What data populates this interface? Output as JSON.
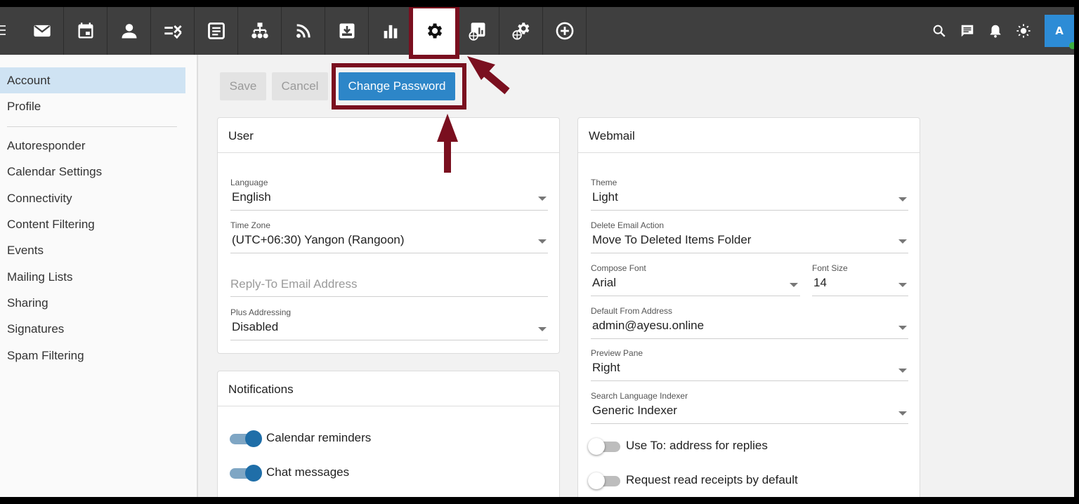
{
  "nav": {
    "icons": [
      "mail-icon",
      "calendar-icon",
      "contacts-icon",
      "tasks-icon",
      "notes-icon",
      "sitemap-icon",
      "rss-icon",
      "archive-icon",
      "reports-icon",
      "settings-gear-icon",
      "domain-reports-icon",
      "domain-settings-icon",
      "add-icon"
    ],
    "active": "settings-gear-icon"
  },
  "topright": {
    "icons": [
      "search-icon",
      "chat-icon",
      "bell-icon",
      "brightness-icon"
    ],
    "avatar_initial": "A"
  },
  "sidebar": {
    "items": [
      "Account",
      "Profile",
      "Autoresponder",
      "Calendar Settings",
      "Connectivity",
      "Content Filtering",
      "Events",
      "Mailing Lists",
      "Sharing",
      "Signatures",
      "Spam Filtering"
    ],
    "active": "Account"
  },
  "toolbar": {
    "save_label": "Save",
    "cancel_label": "Cancel",
    "change_password_label": "Change Password"
  },
  "user": {
    "title": "User",
    "language": {
      "label": "Language",
      "value": "English"
    },
    "timezone": {
      "label": "Time Zone",
      "value": "(UTC+06:30) Yangon (Rangoon)"
    },
    "reply_to": {
      "placeholder": "Reply-To Email Address"
    },
    "plus_addressing": {
      "label": "Plus Addressing",
      "value": "Disabled"
    }
  },
  "notifications": {
    "title": "Notifications",
    "items": [
      {
        "label": "Calendar reminders",
        "on": true
      },
      {
        "label": "Chat messages",
        "on": true
      }
    ]
  },
  "webmail": {
    "title": "Webmail",
    "theme": {
      "label": "Theme",
      "value": "Light"
    },
    "delete_action": {
      "label": "Delete Email Action",
      "value": "Move To Deleted Items Folder"
    },
    "compose_font": {
      "label": "Compose Font",
      "value": "Arial"
    },
    "font_size": {
      "label": "Font Size",
      "value": "14"
    },
    "default_from": {
      "label": "Default From Address",
      "value": "admin@ayesu.online"
    },
    "preview_pane": {
      "label": "Preview Pane",
      "value": "Right"
    },
    "search_indexer": {
      "label": "Search Language Indexer",
      "value": "Generic Indexer"
    },
    "toggles": [
      {
        "label": "Use To: address for replies",
        "on": false
      },
      {
        "label": "Request read receipts by default",
        "on": false
      }
    ]
  },
  "colors": {
    "accent": "#2d86c8",
    "annotation": "#7a0f1f",
    "topbar": "#3f3f3f",
    "sidebar_active": "#cfe3f3",
    "toggle_on": "#1f6ea8"
  }
}
